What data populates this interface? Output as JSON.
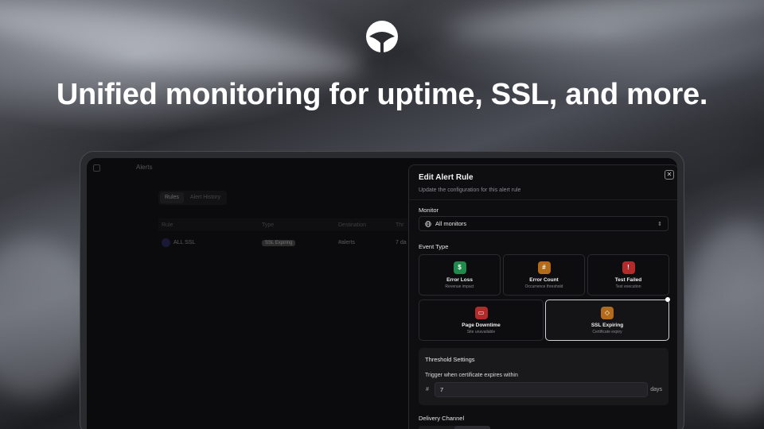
{
  "hero": {
    "headline": "Unified monitoring for uptime, SSL, and more."
  },
  "app": {
    "title": "Alerts",
    "tabs": [
      {
        "label": "Rules",
        "active": true
      },
      {
        "label": "Alert History",
        "active": false
      }
    ],
    "table": {
      "headers": [
        "Rule",
        "Type",
        "Destination",
        "Thr"
      ],
      "rows": [
        {
          "rule": "ALL SSL",
          "type": "SSL Expiring",
          "destination": "#alerts",
          "threshold": "7 da"
        }
      ]
    }
  },
  "modal": {
    "title": "Edit Alert Rule",
    "subtitle": "Update the configuration for this alert rule",
    "close_icon": "close-icon",
    "monitor": {
      "label": "Monitor",
      "value": "All monitors",
      "icon": "globe-icon"
    },
    "event_type": {
      "label": "Event Type",
      "options": [
        {
          "name": "Error Loss",
          "desc": "Revenue impact",
          "icon": "dollar-icon",
          "glyph": "$",
          "color": "#1f8a4c",
          "selected": false
        },
        {
          "name": "Error Count",
          "desc": "Occurrence threshold",
          "icon": "hash-icon",
          "glyph": "#",
          "color": "#b36b1a",
          "selected": false
        },
        {
          "name": "Test Failed",
          "desc": "Test execution",
          "icon": "warning-icon",
          "glyph": "!",
          "color": "#b32a2a",
          "selected": false
        },
        {
          "name": "Page Downtime",
          "desc": "Site unavailable",
          "icon": "monitor-icon",
          "glyph": "▭",
          "color": "#b32a2a",
          "selected": false
        },
        {
          "name": "SSL Expiring",
          "desc": "Certificate expiry",
          "icon": "shield-icon",
          "glyph": "◇",
          "color": "#b36b1a",
          "selected": true
        }
      ]
    },
    "threshold": {
      "title": "Threshold Settings",
      "label": "Trigger when certificate expires within",
      "prefix": "#",
      "value": "7",
      "unit": "days"
    },
    "delivery": {
      "label": "Delivery Channel"
    }
  }
}
